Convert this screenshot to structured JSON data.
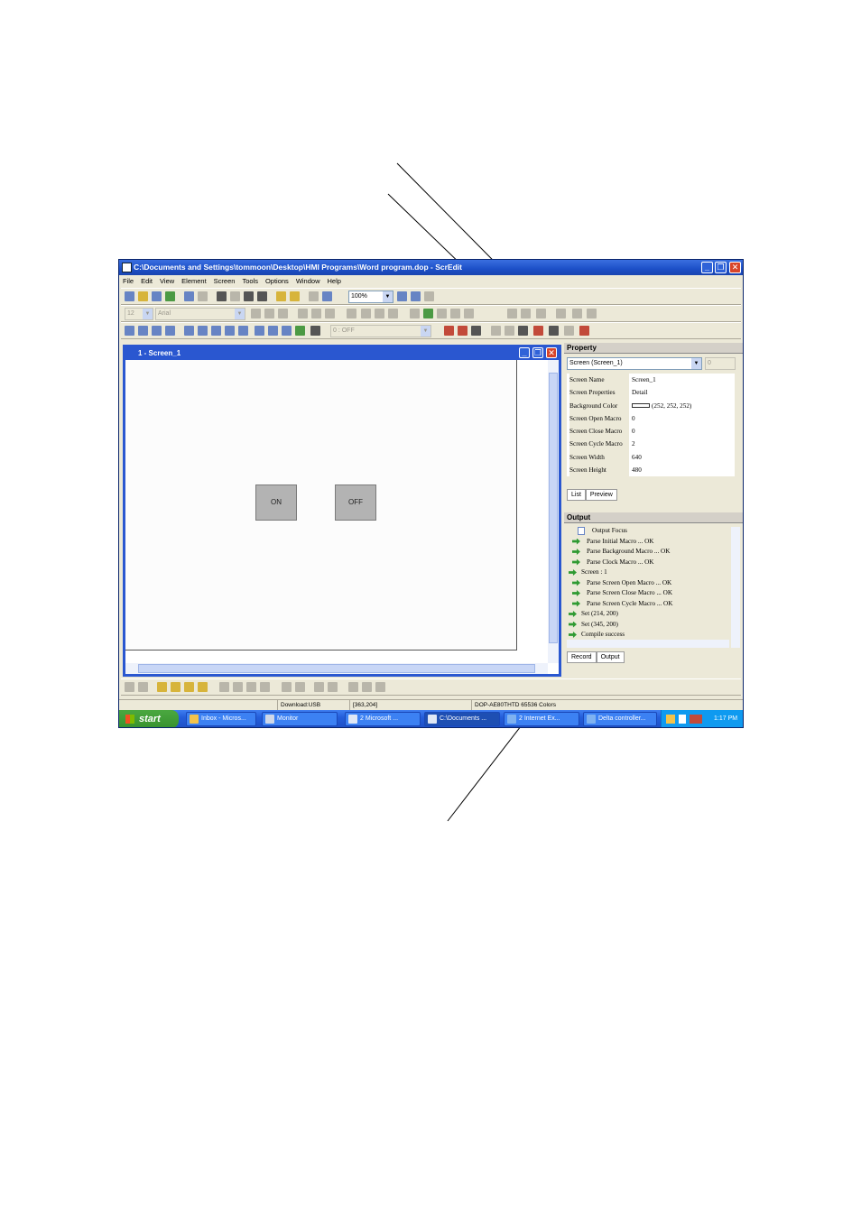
{
  "window": {
    "title": "C:\\Documents and Settings\\tommoon\\Desktop\\HMI Programs\\Word program.dop - ScrEdit",
    "minimize_label": "_",
    "maximize_label": "❐",
    "close_label": "✕"
  },
  "menu": [
    "File",
    "Edit",
    "View",
    "Element",
    "Screen",
    "Tools",
    "Options",
    "Window",
    "Help"
  ],
  "toolbar": {
    "zoom": "100%",
    "font_size": "12",
    "font_name": "Arial",
    "state": "0 : OFF"
  },
  "screen_window": {
    "title": "1 - Screen_1",
    "buttons": [
      {
        "label": "ON"
      },
      {
        "label": "OFF"
      }
    ]
  },
  "property_panel": {
    "title": "Property",
    "object_select": "Screen (Screen_1)",
    "spin_value": "0",
    "rows": [
      {
        "key": "Screen Name",
        "value": "Screen_1"
      },
      {
        "key": "Screen Properties",
        "value": "Detail"
      },
      {
        "key": "Background Color",
        "value": "(252, 252, 252)"
      },
      {
        "key": "Screen Open Macro",
        "value": "0"
      },
      {
        "key": "Screen Close Macro",
        "value": "0"
      },
      {
        "key": "Screen Cycle Macro",
        "value": "2"
      },
      {
        "key": "Screen Width",
        "value": "640"
      },
      {
        "key": "Screen Height",
        "value": "480"
      }
    ],
    "tabs": [
      "List",
      "Preview"
    ],
    "background_color_swatch": "#fcfcfc"
  },
  "output_panel": {
    "title": "Output",
    "header": "Output Focus",
    "lines": [
      "Parse Initial Macro ... OK",
      "Parse Background Macro ... OK",
      "Parse Clock Macro ... OK",
      "Screen : 1",
      "Parse Screen Open Macro ... OK",
      "Parse Screen Close Macro ... OK",
      "Parse Screen Cycle Macro ... OK",
      "Set (214, 200)",
      "Set (345, 200)",
      "Compile success"
    ],
    "tabs": [
      "Record",
      "Output"
    ]
  },
  "statusbar": {
    "download": "Download:USB",
    "coords": "[363,204]",
    "model": "DOP-AE80THTD 65536 Colors"
  },
  "taskbar": {
    "start_label": "start",
    "items": [
      "Inbox - Micros...",
      "Monitor",
      "2 Microsoft ...",
      "C:\\Documents ...",
      "2 Internet Ex...",
      "Delta controller..."
    ],
    "clock": "1:17 PM"
  },
  "colors": {
    "titlebar": "#2a57d0",
    "taskbar": "#245edb",
    "start_button": "#38922f",
    "hmi_button": "#b3b3b3"
  }
}
